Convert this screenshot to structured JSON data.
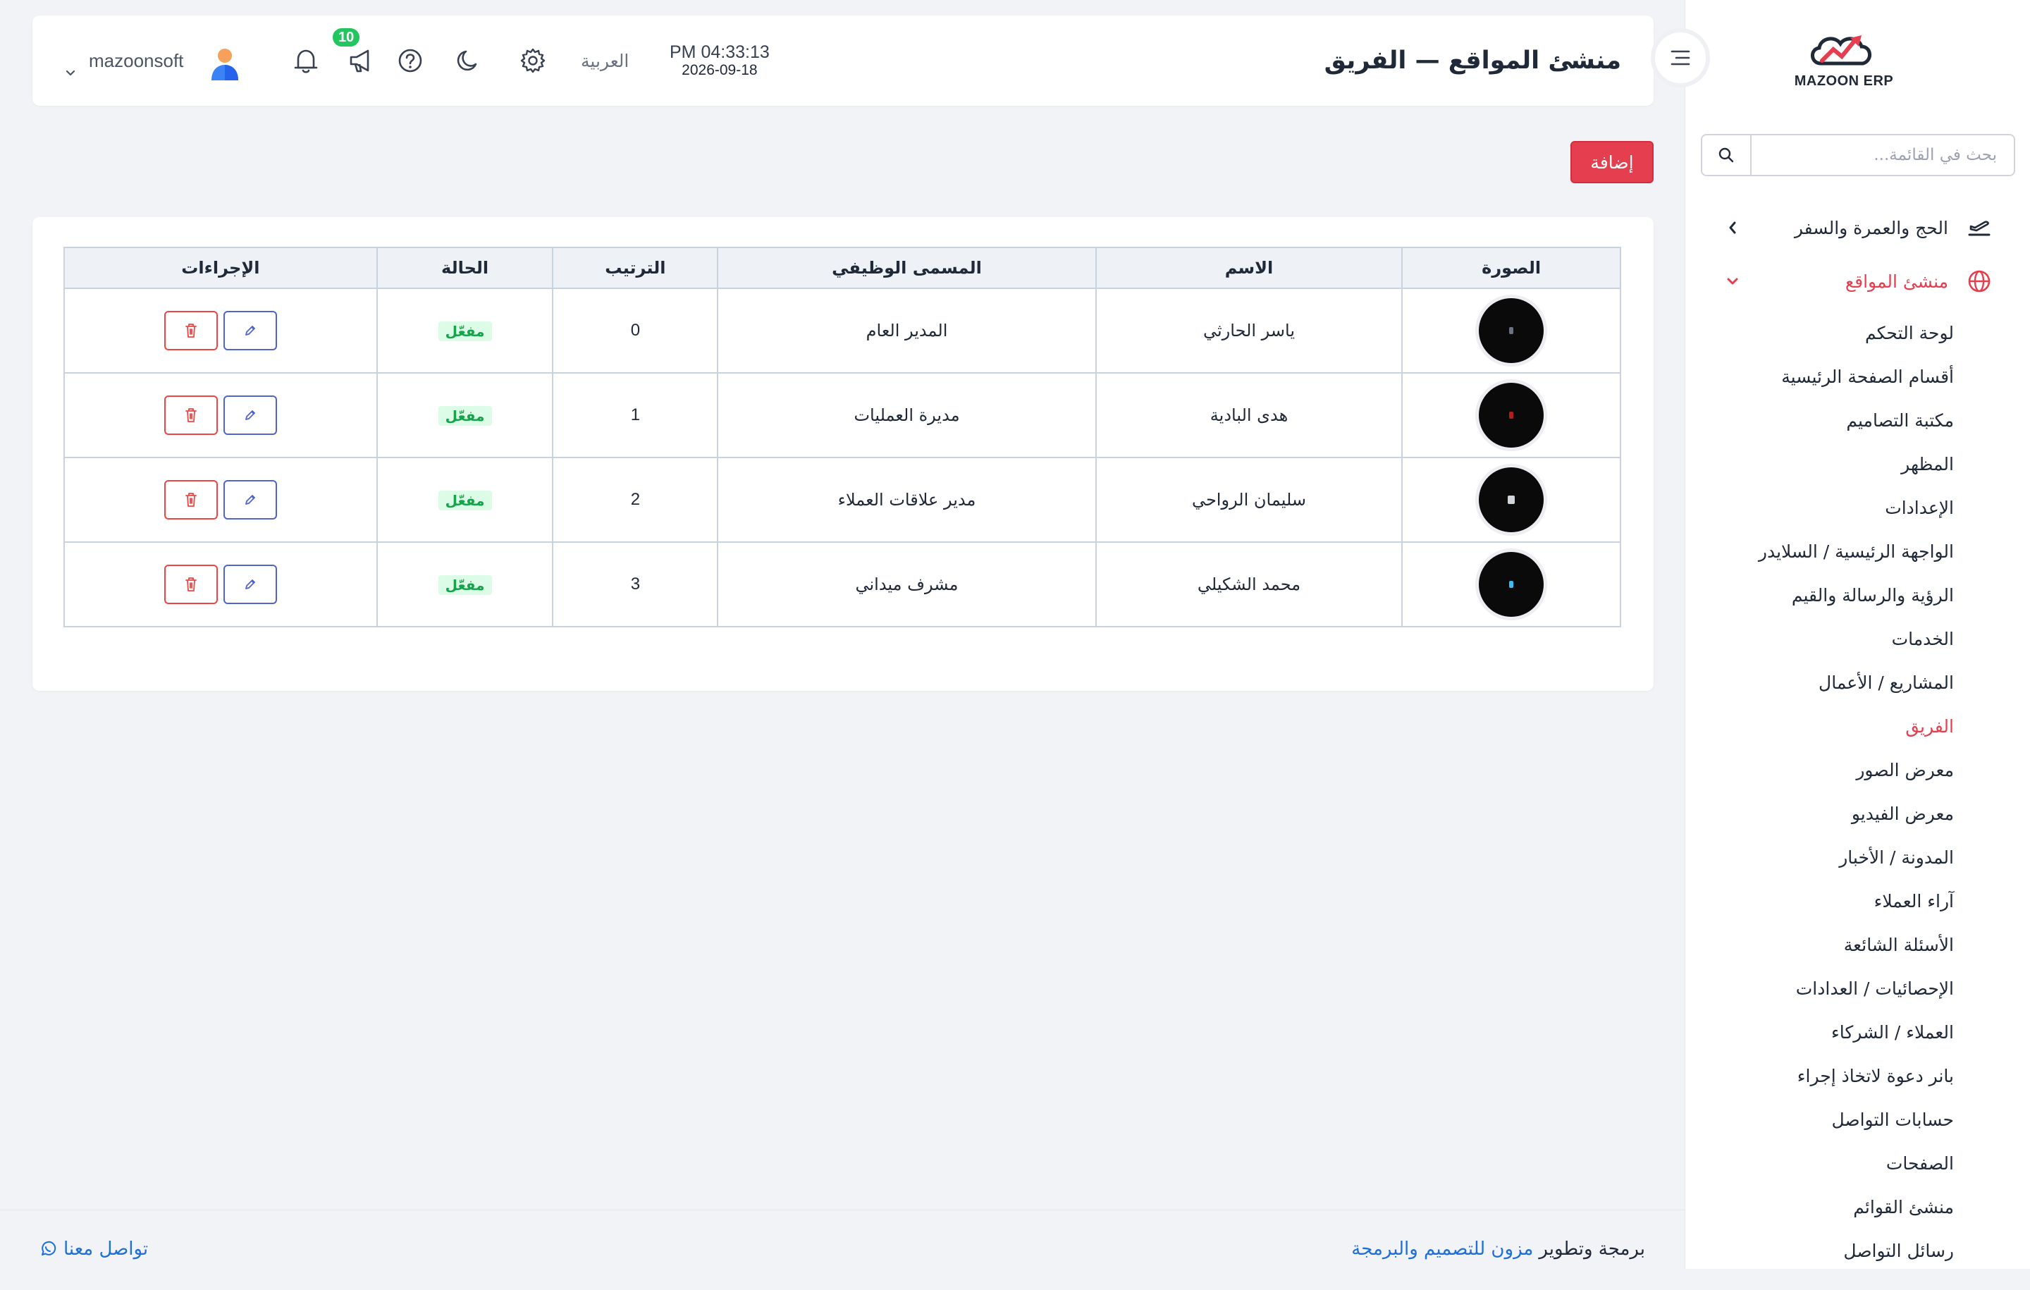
{
  "brand": {
    "logo_text": "MAZOON ERP"
  },
  "search": {
    "placeholder": "بحث في القائمة..."
  },
  "sidebar": {
    "groups": [
      {
        "label": "الحج والعمرة والسفر",
        "icon": "plane-icon"
      },
      {
        "label": "منشئ المواقع",
        "icon": "globe-icon"
      }
    ],
    "items": [
      "لوحة التحكم",
      "أقسام الصفحة الرئيسية",
      "مكتبة التصاميم",
      "المظهر",
      "الإعدادات",
      "الواجهة الرئيسية / السلايدر",
      "الرؤية والرسالة والقيم",
      "الخدمات",
      "المشاريع / الأعمال",
      "الفريق",
      "معرض الصور",
      "معرض الفيديو",
      "المدونة / الأخبار",
      "آراء العملاء",
      "الأسئلة الشائعة",
      "الإحصائيات / العدادات",
      "العملاء / الشركاء",
      "بانر دعوة لاتخاذ إجراء",
      "حسابات التواصل",
      "الصفحات",
      "منشئ القوائم",
      "رسائل التواصل"
    ],
    "active_item": "الفريق"
  },
  "header": {
    "title": "منشئ المواقع — الفريق",
    "time": "PM 04:33:13",
    "date": "2026-09-18",
    "language": "العربية",
    "notifications_count": "10",
    "username": "mazoonsoft"
  },
  "toolbar": {
    "add_label": "إضافة"
  },
  "table": {
    "headers": {
      "photo": "الصورة",
      "name": "الاسم",
      "job": "المسمى الوظيفي",
      "order": "الترتيب",
      "status": "الحالة",
      "actions": "الإجراءات"
    },
    "rows": [
      {
        "name": "ياسر الحارثي",
        "job": "المدير العام",
        "order": "0",
        "status": "مفعّل"
      },
      {
        "name": "هدى البادية",
        "job": "مديرة العمليات",
        "order": "1",
        "status": "مفعّل"
      },
      {
        "name": "سليمان الرواحي",
        "job": "مدير علاقات العملاء",
        "order": "2",
        "status": "مفعّل"
      },
      {
        "name": "محمد الشكيلي",
        "job": "مشرف ميداني",
        "order": "3",
        "status": "مفعّل"
      }
    ]
  },
  "footer": {
    "credit_prefix": "برمجة وتطوير",
    "credit_link": "مزون للتصميم والبرمجة",
    "contact_label": "تواصل معنا"
  },
  "colors": {
    "accent": "#e53e4e",
    "success": "#22c55e",
    "link": "#1e6fd9",
    "edit": "#4f63d2"
  }
}
